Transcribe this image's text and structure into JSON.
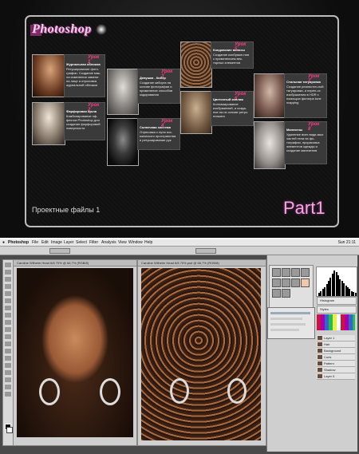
{
  "menu": {
    "logo": "Photoshop",
    "footer": "Проектные файлы 1",
    "part": "Part1",
    "lessons": [
      {
        "num": "Урок 1",
        "title": "Журнальная обложка",
        "desc": "Ретуширование фото-графии. Создание мак-ла изменения замени на лице и отрисовка журнальной обложки"
      },
      {
        "num": "Урок 2",
        "title": "Фарфоровая кукла",
        "desc": "Комбинирование эф-фектов Photoshop для создания фарфоровой поверхности"
      },
      {
        "num": "Урок 3",
        "title": "Девушка - Кибер",
        "desc": "Создание киборга на основе фотографии и применение способов кодирования"
      },
      {
        "num": "Урок 4",
        "title": "Солнечная система",
        "desc": "Отрисовка с нуля кос-мического пространства и ретуширование рук"
      },
      {
        "num": "Урок 5",
        "title": "Колдовские волосы",
        "desc": "Создание изображе-ния с применением век-торных элементов"
      },
      {
        "num": "Урок 6",
        "title": "Цветочный коллаж",
        "desc": "Коллажирование изображений, и созда-ние на их основе ретро плаката"
      },
      {
        "num": "Урок 7",
        "title": "Стильная татуировка",
        "desc": "Создание реалистич-ной татуировки, и перен-ос изображения в HDR с помощью фильтра tone mapping"
      },
      {
        "num": "Урок 8",
        "title": "Манекены",
        "desc": "Удаление всех види-мых частей тела на фо-тографии, прорисовка элементов одежды и создание манекенов"
      }
    ]
  },
  "photoshop": {
    "app_menu": [
      "Photoshop",
      "File",
      "Edit",
      "Image",
      "Layer",
      "Select",
      "Filter",
      "Analysis",
      "View",
      "Window",
      "Help"
    ],
    "clock": "Sun 21:11",
    "doc1_tab": "Caroline Wilhelm Head 6/8 70% @ 66,7% (RGB/8)",
    "doc2_tab": "Caroline Wilhelm Head 6/8 70%.psd @ 66,7% (RGB/8)",
    "layers": [
      "Layer 1",
      "Hair",
      "Background",
      "Curls",
      "Pattern",
      "Shadow",
      "Layer 5"
    ],
    "panel_labels": {
      "histogram": "Histogram",
      "styles": "Styles"
    },
    "histogram_heights": [
      4,
      6,
      8,
      10,
      14,
      18,
      22,
      26,
      30,
      28,
      24,
      20,
      18,
      15,
      12,
      10,
      8,
      6,
      5,
      4
    ],
    "colors": {
      "accent": "#ff3b84",
      "part": "#f4a8e2",
      "panel": "#cfcfcf"
    }
  }
}
